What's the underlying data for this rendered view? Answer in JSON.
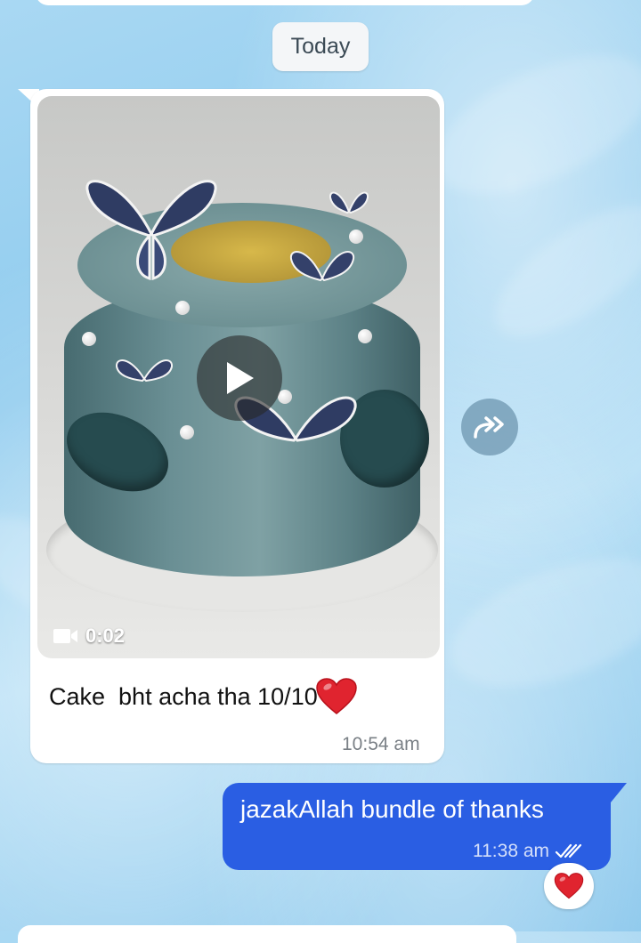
{
  "date_divider": {
    "label": "Today"
  },
  "incoming_message": {
    "media": {
      "type": "video",
      "duration": "0:02",
      "icon": "video-camera-icon"
    },
    "caption": "Cake  bht acha tha 10/10",
    "caption_emoji": "heart-emoji",
    "time": "10:54 am"
  },
  "forward_button": {
    "icon": "forward-arrow-icon"
  },
  "outgoing_message": {
    "text": "jazakAllah bundle of thanks",
    "time": "11:38 am",
    "status_icon": "double-check-icon",
    "reaction": "heart-emoji"
  },
  "colors": {
    "outgoing_bubble": "#2a5ee3",
    "incoming_bubble": "#ffffff",
    "heart": "#e0242f"
  }
}
